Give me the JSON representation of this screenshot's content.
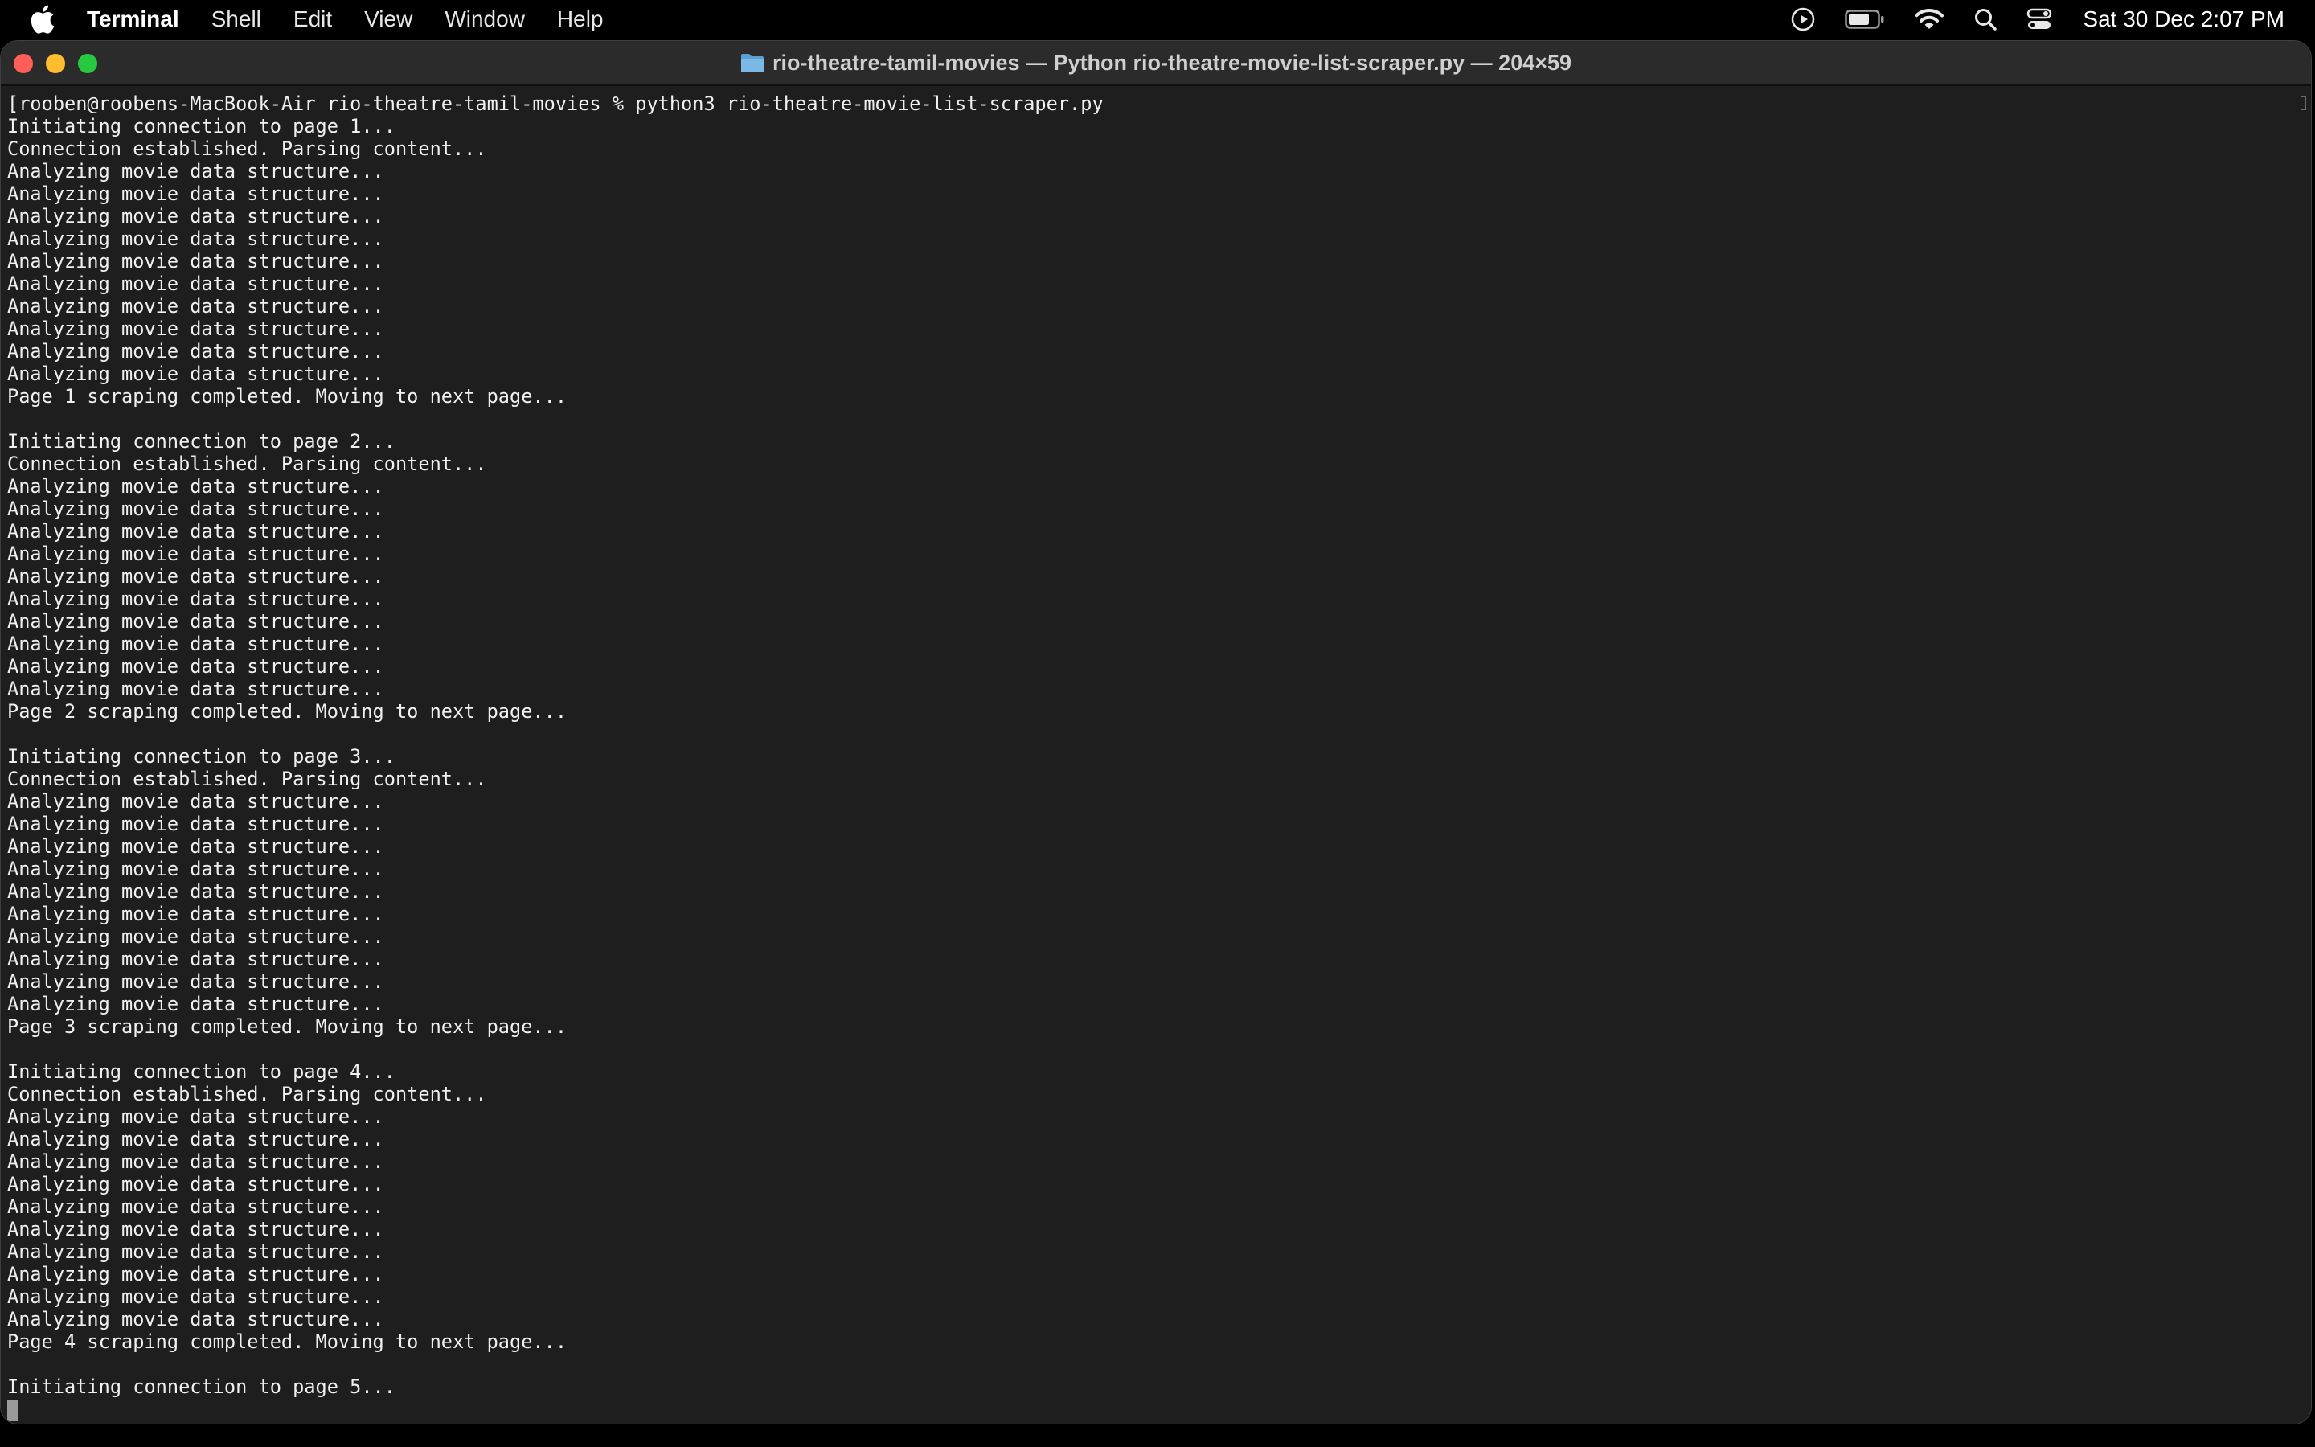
{
  "menubar": {
    "app_name": "Terminal",
    "items": [
      "Shell",
      "Edit",
      "View",
      "Window",
      "Help"
    ],
    "clock": "Sat 30 Dec  2:07 PM",
    "status_icons": [
      "screen-record-icon",
      "battery-icon",
      "wifi-icon",
      "search-icon",
      "control-center-icon"
    ]
  },
  "window": {
    "title": "rio-theatre-tamil-movies — Python rio-theatre-movie-list-scraper.py — 204×59",
    "colors": {
      "close": "#ff5f57",
      "minimize": "#febc2e",
      "maximize": "#28c840"
    }
  },
  "terminal": {
    "lines": [
      "[rooben@roobens-MacBook-Air rio-theatre-tamil-movies % python3 rio-theatre-movie-list-scraper.py",
      "Initiating connection to page 1...",
      "Connection established. Parsing content...",
      "Analyzing movie data structure...",
      "Analyzing movie data structure...",
      "Analyzing movie data structure...",
      "Analyzing movie data structure...",
      "Analyzing movie data structure...",
      "Analyzing movie data structure...",
      "Analyzing movie data structure...",
      "Analyzing movie data structure...",
      "Analyzing movie data structure...",
      "Analyzing movie data structure...",
      "Page 1 scraping completed. Moving to next page...",
      "",
      "Initiating connection to page 2...",
      "Connection established. Parsing content...",
      "Analyzing movie data structure...",
      "Analyzing movie data structure...",
      "Analyzing movie data structure...",
      "Analyzing movie data structure...",
      "Analyzing movie data structure...",
      "Analyzing movie data structure...",
      "Analyzing movie data structure...",
      "Analyzing movie data structure...",
      "Analyzing movie data structure...",
      "Analyzing movie data structure...",
      "Page 2 scraping completed. Moving to next page...",
      "",
      "Initiating connection to page 3...",
      "Connection established. Parsing content...",
      "Analyzing movie data structure...",
      "Analyzing movie data structure...",
      "Analyzing movie data structure...",
      "Analyzing movie data structure...",
      "Analyzing movie data structure...",
      "Analyzing movie data structure...",
      "Analyzing movie data structure...",
      "Analyzing movie data structure...",
      "Analyzing movie data structure...",
      "Analyzing movie data structure...",
      "Page 3 scraping completed. Moving to next page...",
      "",
      "Initiating connection to page 4...",
      "Connection established. Parsing content...",
      "Analyzing movie data structure...",
      "Analyzing movie data structure...",
      "Analyzing movie data structure...",
      "Analyzing movie data structure...",
      "Analyzing movie data structure...",
      "Analyzing movie data structure...",
      "Analyzing movie data structure...",
      "Analyzing movie data structure...",
      "Analyzing movie data structure...",
      "Analyzing movie data structure...",
      "Page 4 scraping completed. Moving to next page...",
      "",
      "Initiating connection to page 5..."
    ]
  }
}
